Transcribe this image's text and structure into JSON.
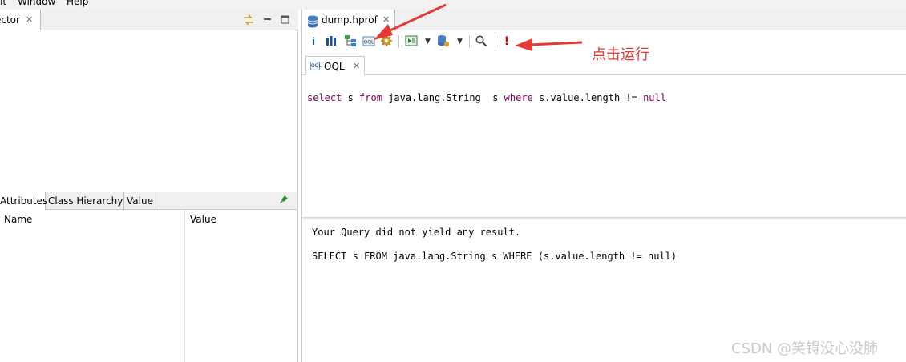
{
  "menu": {
    "edit_fragment": "it",
    "window": "Window",
    "help": "Help"
  },
  "inspector": {
    "tab_label": "ector",
    "close": "✕"
  },
  "attributes": {
    "tabs": [
      "Attributes",
      "Class Hierarchy",
      "Value"
    ],
    "columns": [
      "Name",
      "Value"
    ]
  },
  "editor": {
    "tab_label": "dump.hprof",
    "close": "✕"
  },
  "toolbar": {
    "info": "i",
    "histogram": "histogram-icon",
    "dominator": "dominator-tree-icon",
    "oql": "oql-icon",
    "gear": "gear-icon",
    "run": "!"
  },
  "oql_tab": {
    "label": "OQL",
    "icon_text": "OQL",
    "close": "✕"
  },
  "query": {
    "kw_select": "select",
    "t1": " s ",
    "kw_from": "from",
    "t2": " java.lang.String  s ",
    "kw_where": "where",
    "t3": " s.value.length != ",
    "kw_null": "null"
  },
  "result": {
    "line1": "Your Query did not yield any result.",
    "line2": "SELECT s FROM java.lang.String s WHERE (s.value.length != null)"
  },
  "annotation": "点击运行",
  "watermark": "CSDN @笑锝没心没肺",
  "colors": {
    "keyword": "#7f0055",
    "annotation": "#e53935",
    "run_icon": "#d00000"
  }
}
